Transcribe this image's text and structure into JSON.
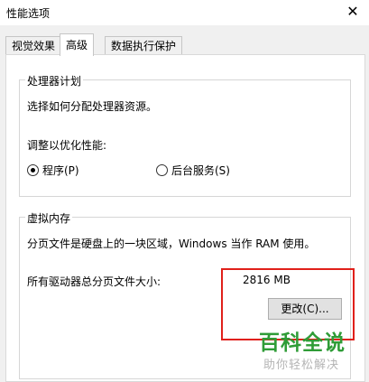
{
  "window": {
    "title": "性能选项",
    "close_glyph": "✕"
  },
  "tabs": [
    {
      "label": "视觉效果",
      "active": false
    },
    {
      "label": "高级",
      "active": true
    },
    {
      "label": "数据执行保护",
      "active": false
    }
  ],
  "processor_group": {
    "title": "处理器计划",
    "description": "选择如何分配处理器资源。",
    "optimize_label": "调整以优化性能:",
    "options": [
      {
        "label": "程序(P)",
        "selected": true
      },
      {
        "label": "后台服务(S)",
        "selected": false
      }
    ]
  },
  "virtual_memory_group": {
    "title": "虚拟内存",
    "description": "分页文件是硬盘上的一块区域，Windows 当作 RAM 使用。",
    "total_label": "所有驱动器总分页文件大小:",
    "total_value": "2816 MB",
    "change_button": "更改(C)..."
  },
  "watermark": {
    "logo_text": "百科全说",
    "sub_text": "助你轻松解决"
  },
  "colors": {
    "highlight": "#e0201a",
    "logo_green": "#2f9c37"
  }
}
